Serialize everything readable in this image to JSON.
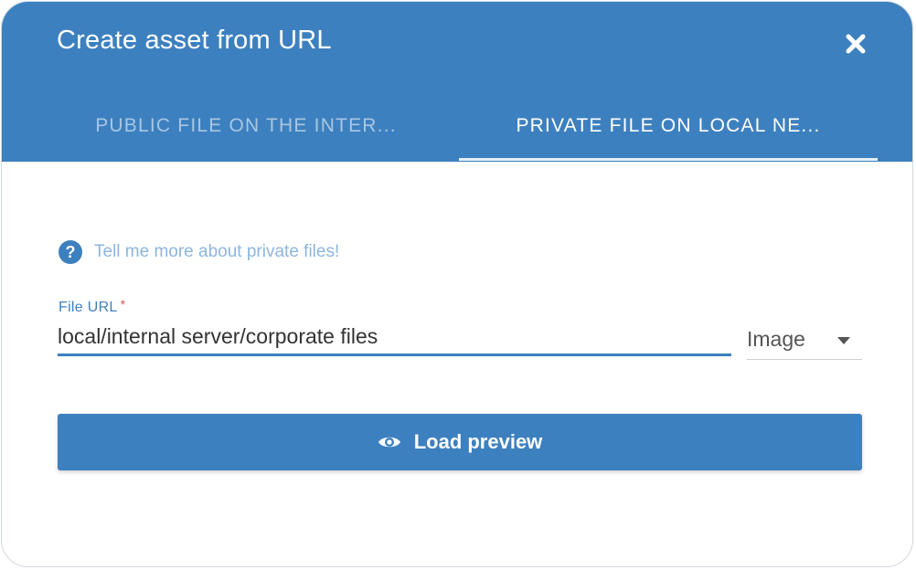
{
  "dialog": {
    "title": "Create asset from URL",
    "close_icon": "close-icon"
  },
  "tabs": [
    {
      "label": "PUBLIC FILE ON THE INTER...",
      "active": false
    },
    {
      "label": "PRIVATE FILE ON LOCAL NE...",
      "active": true
    }
  ],
  "help": {
    "icon": "question-circle-icon",
    "text": "Tell me more about private files!"
  },
  "form": {
    "url_label": "File URL",
    "required_marker": "*",
    "url_value": "local/internal server/corporate files",
    "type_value": "Image",
    "type_icon": "caret-down-icon"
  },
  "action": {
    "icon": "eye-icon",
    "label": "Load preview"
  },
  "colors": {
    "primary": "#3d80bf",
    "link": "#8db6df",
    "required": "#d9534f"
  }
}
